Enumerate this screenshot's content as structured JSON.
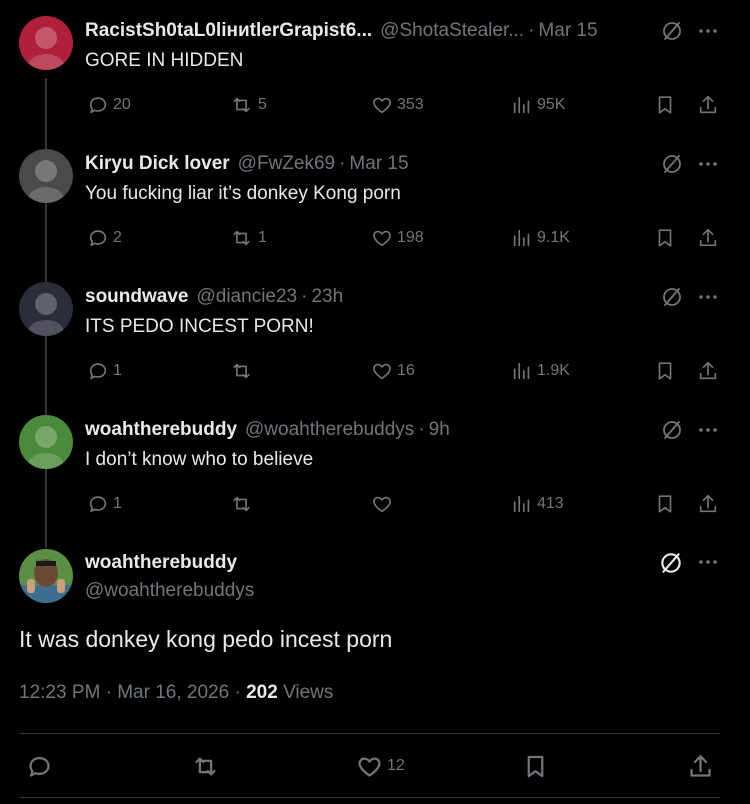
{
  "replies": [
    {
      "name": "RacistSh0taL0liниtlerGrapist6...",
      "handle": "@ShotaStealer...",
      "date": "Mar 15",
      "text": "GORE IN HIDDEN",
      "replies": "20",
      "reposts": "5",
      "likes": "353",
      "views": "95K",
      "avatar_color": "#b0203a"
    },
    {
      "name": "Kiryu Dick lover",
      "handle": "@FwZek69",
      "date": "Mar 15",
      "text": "You fucking liar it’s donkey Kong porn",
      "replies": "2",
      "reposts": "1",
      "likes": "198",
      "views": "9.1K",
      "avatar_color": "#4a4a4a"
    },
    {
      "name": "soundwave",
      "handle": "@diancie23",
      "date": "23h",
      "text": "ITS PEDO INCEST PORN!",
      "replies": "1",
      "reposts": "",
      "likes": "16",
      "views": "1.9K",
      "avatar_color": "#2b2d3a"
    },
    {
      "name": "woahtherebuddy",
      "handle": "@woahtherebuddys",
      "date": "9h",
      "text": "I don’t know who to believe",
      "replies": "1",
      "reposts": "",
      "likes": "",
      "views": "413",
      "avatar_color": "#4a8a3a"
    }
  ],
  "main_post": {
    "name": "woahtherebuddy",
    "handle": "@woahtherebuddys",
    "text": "It was donkey kong pedo incest porn",
    "time": "12:23 PM",
    "date": "Mar 16, 2026",
    "views_count": "202",
    "views_label": "Views",
    "likes": "12"
  },
  "separator": "·"
}
